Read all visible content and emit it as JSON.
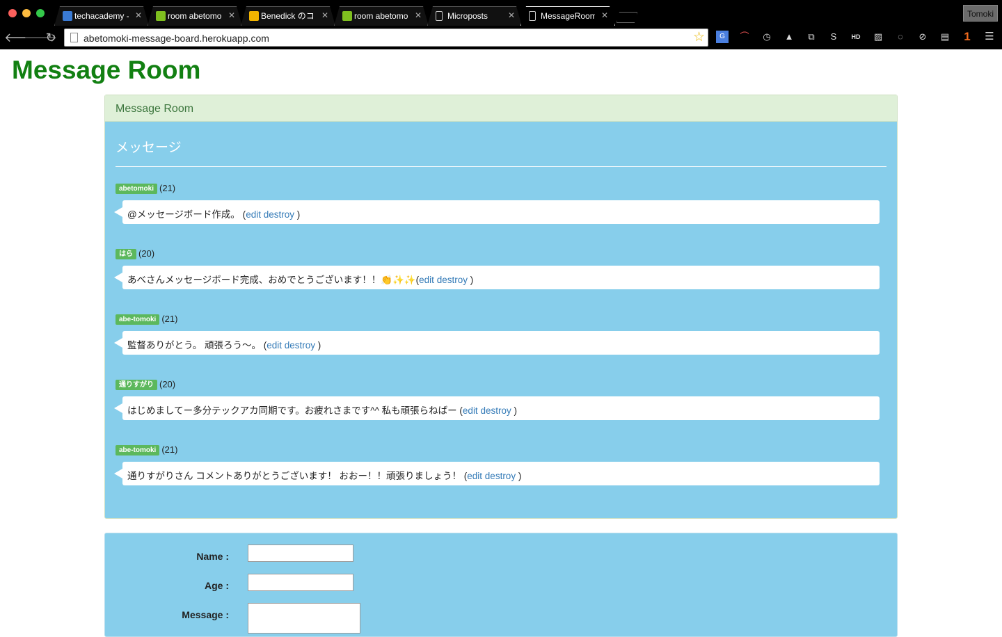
{
  "browser": {
    "tabs": [
      {
        "title": "techacademy -",
        "favicon_color": "#3a7bd5",
        "active": false
      },
      {
        "title": "room abetomoki",
        "favicon_color": "#7fbf1f",
        "active": false
      },
      {
        "title": "Benedick のコヒ",
        "favicon_color": "#f2b400",
        "active": false
      },
      {
        "title": "room abetomoki",
        "favicon_color": "#7fbf1f",
        "active": false
      },
      {
        "title": "Microposts",
        "favicon_color": "#ffffff",
        "active": false
      },
      {
        "title": "MessageRoom",
        "favicon_color": "#ffffff",
        "active": true
      }
    ],
    "profile_name": "Tomoki",
    "url": "abetomoki-message-board.herokuapp.com",
    "extension_badge": "1"
  },
  "page": {
    "title": "Message Room",
    "panel_heading": "Message Room",
    "section_title": "メッセージ",
    "messages": [
      {
        "name": "abetomoki",
        "age": "(21)",
        "text": "@メッセージボード作成。 (",
        "edit": "edit",
        "destroy": "destroy",
        "close": " )"
      },
      {
        "name": "はら",
        "age": "(20)",
        "text": "あべさんメッセージボード完成、おめでとうございます！！👏✨✨(",
        "edit": "edit",
        "destroy": "destroy",
        "close": " )"
      },
      {
        "name": "abe-tomoki",
        "age": "(21)",
        "text": "監督ありがとう。 頑張ろう〜。 (",
        "edit": "edit",
        "destroy": "destroy",
        "close": " )"
      },
      {
        "name": "通りすがり",
        "age": "(20)",
        "text": "はじめましてー多分テックアカ同期です。お疲れさまです^^ 私も頑張らねばー (",
        "edit": "edit",
        "destroy": "destroy",
        "close": " )"
      },
      {
        "name": "abe-tomoki",
        "age": "(21)",
        "text": "通りすがりさん コメントありがとうございます！ おおー！！頑張りましょう！ (",
        "edit": "edit",
        "destroy": "destroy",
        "close": " )"
      }
    ],
    "form": {
      "name_label": "Name :",
      "age_label": "Age :",
      "message_label": "Message :",
      "name_value": "",
      "age_value": "",
      "message_value": ""
    },
    "colors": {
      "title_green": "#128012",
      "panel_blue": "#87ceeb",
      "heading_green_bg": "#dff0d8",
      "badge_green": "#5cb85c",
      "link_blue": "#337ab7"
    }
  }
}
